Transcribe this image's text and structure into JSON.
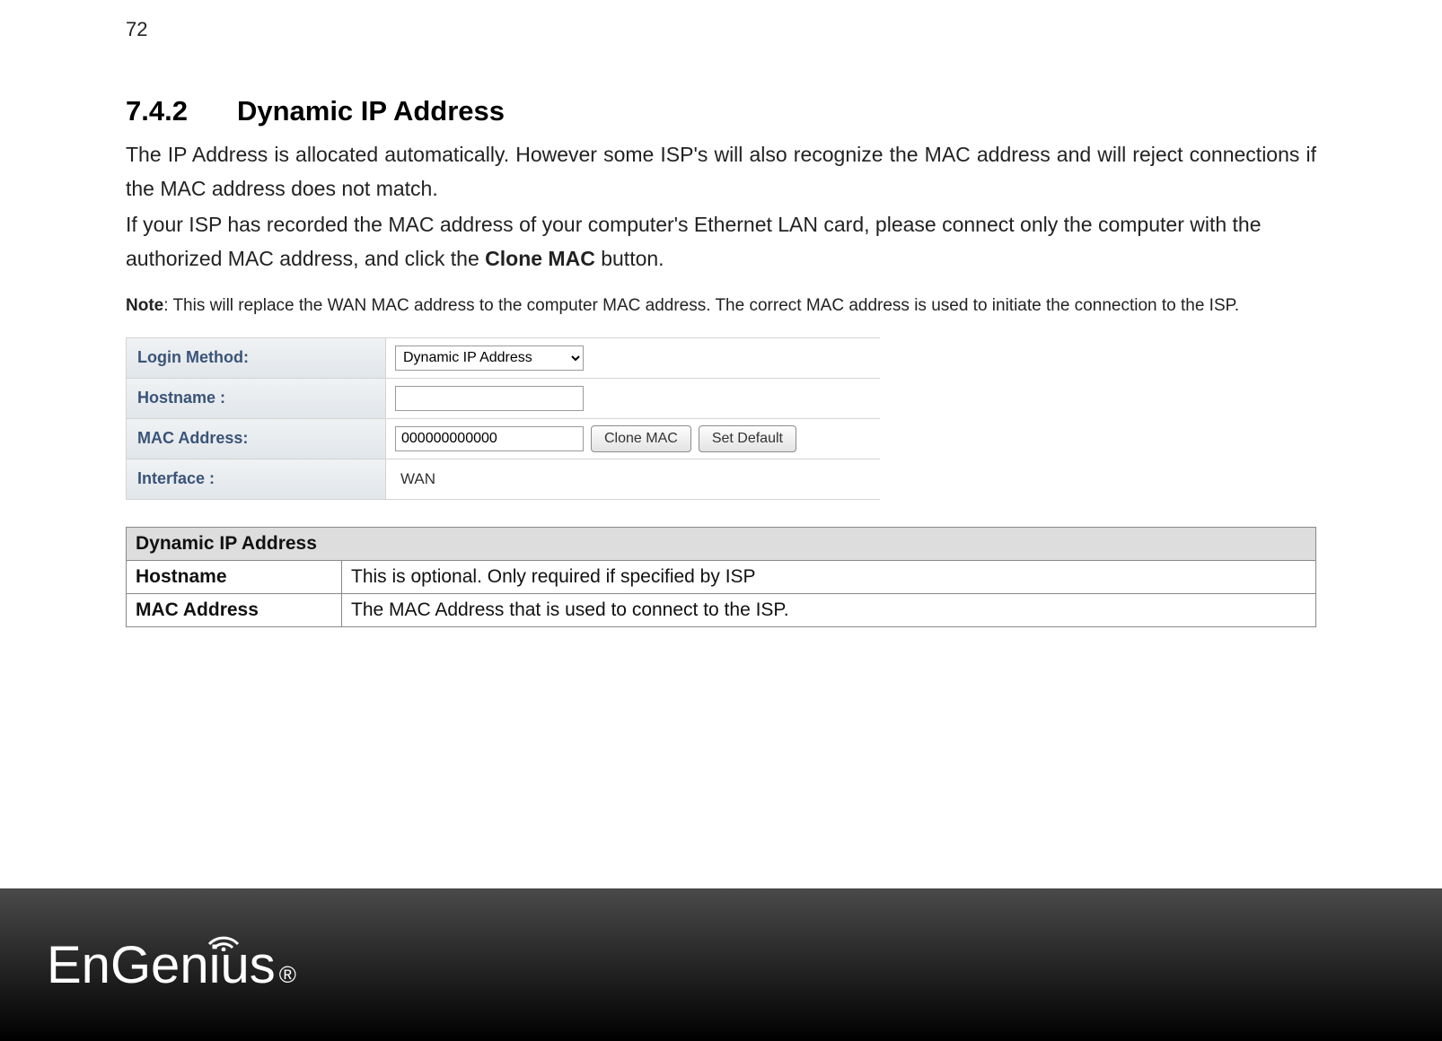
{
  "page_number": "72",
  "heading": {
    "number": "7.4.2",
    "title": "Dynamic IP Address"
  },
  "paragraphs": {
    "p1": "The IP Address is allocated automatically. However some ISP's will also recognize the MAC address and will reject connections if the MAC address does not match.",
    "p2a": "If your ISP has recorded the MAC address of your computer's Ethernet LAN card, please connect only the computer with the authorized MAC address, and click the ",
    "p2_bold": "Clone MAC",
    "p2b": " button."
  },
  "note": {
    "label": "Note",
    "text": ": This will replace the WAN MAC address to the computer MAC address. The correct MAC address is used to initiate the connection to the ISP."
  },
  "form": {
    "login_method": {
      "label": "Login Method:",
      "value": "Dynamic IP Address"
    },
    "hostname": {
      "label": "Hostname :",
      "value": ""
    },
    "mac_address": {
      "label": "MAC Address:",
      "value": "000000000000"
    },
    "interface": {
      "label": "Interface :",
      "value": "WAN"
    },
    "buttons": {
      "clone_mac": "Clone MAC",
      "set_default": "Set Default"
    }
  },
  "desc_table": {
    "header": "Dynamic IP Address",
    "rows": [
      {
        "label": "Hostname",
        "desc": "This is optional. Only required if specified by ISP"
      },
      {
        "label": "MAC Address",
        "desc": "The MAC Address that is used to connect to the ISP."
      }
    ]
  },
  "footer": {
    "brand": "EnGenius",
    "reg": "®"
  }
}
